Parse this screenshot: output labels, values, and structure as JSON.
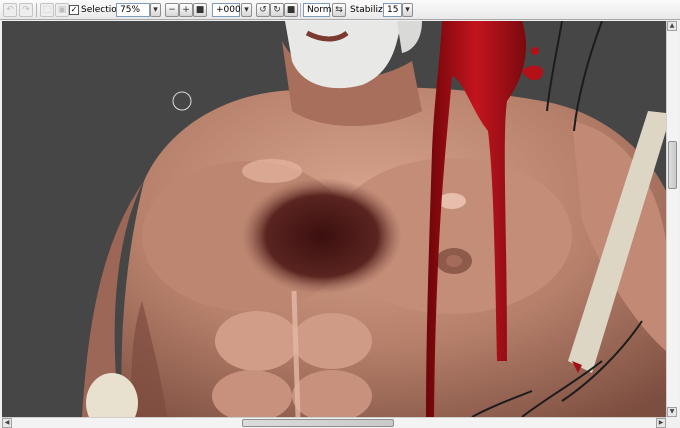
{
  "toolbar": {
    "selection_label": "Selection",
    "selection_checked": "✓",
    "zoom": "75%",
    "rotation": "+000°",
    "blend_mode": "Normal",
    "stabilizer_label": "Stabilizer",
    "stabilizer_value": "15",
    "dropdown_arrow": "▾"
  },
  "icons": {
    "undo": "undo-icon",
    "redo": "redo-icon",
    "deselect": "deselect-icon",
    "invert": "invert-selection-icon",
    "zoom_out": "zoom-out-icon",
    "zoom_in": "zoom-in-icon",
    "zoom_reset": "zoom-reset-icon",
    "rotate_left": "rotate-left-icon",
    "rotate_right": "rotate-right-icon",
    "rotate_reset": "rotate-reset-icon",
    "flip": "flip-icon"
  },
  "colors": {
    "canvas_bg": "#464646",
    "skin": "#b57f6a",
    "blood": "#a3101a",
    "staff": "#ddd6c4"
  }
}
